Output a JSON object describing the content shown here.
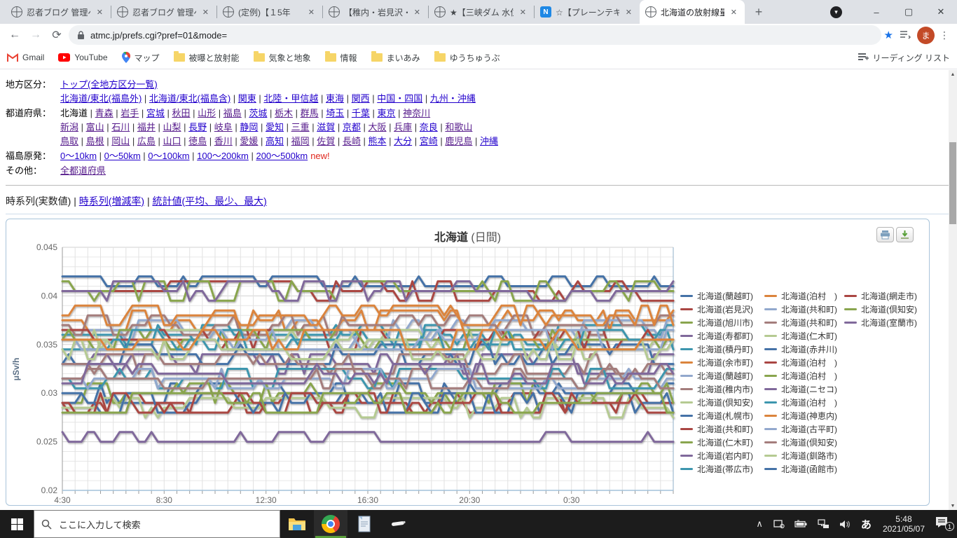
{
  "browser": {
    "tabs": [
      {
        "title": "忍者ブログ 管理ペ-",
        "icon": "globe",
        "active": false
      },
      {
        "title": "忍者ブログ 管理ペ-",
        "icon": "globe",
        "active": false
      },
      {
        "title": "(定例)【１5年",
        "icon": "globe",
        "active": false
      },
      {
        "title": "【稚内・岩見沢・函",
        "icon": "globe",
        "active": false
      },
      {
        "title": "★【三峡ダム 水位",
        "icon": "globe",
        "active": false
      },
      {
        "title": "☆【プレーンテキスト",
        "icon": "note",
        "active": false
      },
      {
        "title": "北海道の放射線量",
        "icon": "globe",
        "active": true
      }
    ],
    "note_icon_letter": "N",
    "new_tab_label": "+",
    "window_controls": {
      "tab_menu": "▾",
      "minimize": "–",
      "maximize": "▢",
      "close": "✕"
    },
    "address": {
      "url": "atmc.jp/prefs.cgi?pref=01&mode="
    },
    "toolbar": {
      "avatar_letter": "ま"
    },
    "bookmarks": [
      {
        "label": "Gmail",
        "icon": "gmail"
      },
      {
        "label": "YouTube",
        "icon": "youtube"
      },
      {
        "label": "マップ",
        "icon": "maps"
      },
      {
        "label": "被曝と放射能",
        "icon": "folder"
      },
      {
        "label": "気象と地象",
        "icon": "folder"
      },
      {
        "label": "情報",
        "icon": "folder"
      },
      {
        "label": "まいあみ",
        "icon": "folder"
      },
      {
        "label": "ゆうちゅうぶ",
        "icon": "folder"
      }
    ],
    "reading_list_label": "リーディング リスト"
  },
  "page": {
    "nav_rows": [
      {
        "label": "地方区分：",
        "lines": [
          [
            {
              "t": "トップ(全地方区分一覧)",
              "v": false
            }
          ],
          [
            {
              "t": "北海道/東北(福島外)",
              "v": false
            },
            {
              "t": "北海道/東北(福島含)",
              "v": false
            },
            {
              "t": "関東",
              "v": false
            },
            {
              "t": "北陸・甲信越",
              "v": false
            },
            {
              "t": "東海",
              "v": false
            },
            {
              "t": "関西",
              "v": false
            },
            {
              "t": "中国・四国",
              "v": false
            },
            {
              "t": "九州・沖縄",
              "v": false
            }
          ]
        ]
      },
      {
        "label": "都道府県：",
        "lines": [
          [
            {
              "t": "北海道",
              "plain": true
            },
            {
              "t": "青森",
              "v": true
            },
            {
              "t": "岩手",
              "v": true
            },
            {
              "t": "宮城",
              "v": false
            },
            {
              "t": "秋田",
              "v": true
            },
            {
              "t": "山形",
              "v": true
            },
            {
              "t": "福島",
              "v": true
            },
            {
              "t": "茨城",
              "v": false
            },
            {
              "t": "栃木",
              "v": true
            },
            {
              "t": "群馬",
              "v": true
            },
            {
              "t": "埼玉",
              "v": false
            },
            {
              "t": "千葉",
              "v": false
            },
            {
              "t": "東京",
              "v": false
            },
            {
              "t": "神奈川",
              "v": true
            }
          ],
          [
            {
              "t": "新潟",
              "v": true
            },
            {
              "t": "富山",
              "v": true
            },
            {
              "t": "石川",
              "v": true
            },
            {
              "t": "福井",
              "v": true
            },
            {
              "t": "山梨",
              "v": true
            },
            {
              "t": "長野",
              "v": false
            },
            {
              "t": "岐阜",
              "v": true
            },
            {
              "t": "静岡",
              "v": false
            },
            {
              "t": "愛知",
              "v": false
            },
            {
              "t": "三重",
              "v": true
            },
            {
              "t": "滋賀",
              "v": false
            },
            {
              "t": "京都",
              "v": false
            },
            {
              "t": "大阪",
              "v": true
            },
            {
              "t": "兵庫",
              "v": true
            },
            {
              "t": "奈良",
              "v": false
            },
            {
              "t": "和歌山",
              "v": true
            }
          ],
          [
            {
              "t": "鳥取",
              "v": true
            },
            {
              "t": "島根",
              "v": true
            },
            {
              "t": "岡山",
              "v": true
            },
            {
              "t": "広島",
              "v": true
            },
            {
              "t": "山口",
              "v": true
            },
            {
              "t": "徳島",
              "v": true
            },
            {
              "t": "香川",
              "v": true
            },
            {
              "t": "愛媛",
              "v": true
            },
            {
              "t": "高知",
              "v": false
            },
            {
              "t": "福岡",
              "v": true
            },
            {
              "t": "佐賀",
              "v": true
            },
            {
              "t": "長崎",
              "v": true
            },
            {
              "t": "熊本",
              "v": false
            },
            {
              "t": "大分",
              "v": false
            },
            {
              "t": "宮崎",
              "v": false
            },
            {
              "t": "鹿児島",
              "v": true
            },
            {
              "t": "沖縄",
              "v": false
            }
          ]
        ]
      },
      {
        "label": "福島原発：",
        "lines": [
          [
            {
              "t": "0～10km",
              "v": false
            },
            {
              "t": "0～50km",
              "v": false
            },
            {
              "t": "0～100km",
              "v": false
            },
            {
              "t": "100～200km",
              "v": false
            },
            {
              "t": "200～500km",
              "v": false,
              "suffix": "new!"
            }
          ]
        ]
      },
      {
        "label": "その他：",
        "lines": [
          [
            {
              "t": "全都道府県",
              "v": true
            }
          ]
        ]
      }
    ],
    "view_tabs": {
      "current": "時系列(実数値)",
      "links": [
        "時系列(増減率)",
        "統計値(平均、最少、最大)"
      ]
    }
  },
  "chart_data": {
    "type": "line",
    "title": "北海道",
    "title_suffix": " (日間)",
    "ylabel": "μSv/h",
    "ylim": [
      0.02,
      0.045
    ],
    "ytick_step": 0.005,
    "grid_step": 0.001,
    "x_labels": [
      "4:30",
      "8:30",
      "12:30",
      "16:30",
      "20:30",
      "0:30"
    ],
    "x_minutes_per_point": 15,
    "points_per_series": 97,
    "value_step": 0.001,
    "legend_columns": [
      14,
      14,
      3
    ],
    "palette": [
      "#4572A7",
      "#AA4643",
      "#89A54E",
      "#80699B",
      "#3D96AE",
      "#DB843D",
      "#92A8CD",
      "#A47D7C",
      "#B5CA92"
    ],
    "series": [
      {
        "name": "北海道(蘭越町)",
        "color_index": 0,
        "base": 0.041,
        "floor": true
      },
      {
        "name": "北海道(岩見沢)",
        "color_index": 1,
        "base": 0.0405
      },
      {
        "name": "北海道(旭川市)",
        "color_index": 2,
        "base": 0.0405
      },
      {
        "name": "北海道(寿都町)",
        "color_index": 3,
        "base": 0.033
      },
      {
        "name": "北海道(積丹町)",
        "color_index": 4,
        "base": 0.036
      },
      {
        "name": "北海道(余市町)",
        "color_index": 5,
        "base": 0.0375
      },
      {
        "name": "北海道(蘭越町)",
        "color_index": 6,
        "base": 0.0365
      },
      {
        "name": "北海道(稚内市)",
        "color_index": 7,
        "base": 0.037
      },
      {
        "name": "北海道(倶知安)",
        "color_index": 8,
        "base": 0.0355
      },
      {
        "name": "北海道(札幌市)",
        "color_index": 0,
        "base": 0.034
      },
      {
        "name": "北海道(共和町)",
        "color_index": 1,
        "base": 0.0355
      },
      {
        "name": "北海道(仁木町)",
        "color_index": 2,
        "base": 0.0355
      },
      {
        "name": "北海道(岩内町)",
        "color_index": 3,
        "base": 0.025,
        "floor": true
      },
      {
        "name": "北海道(帯広市)",
        "color_index": 4,
        "base": 0.0355
      },
      {
        "name": "北海道(泊村　)",
        "color_index": 5,
        "base": 0.038
      },
      {
        "name": "北海道(共和町)",
        "color_index": 6,
        "base": 0.0355
      },
      {
        "name": "北海道(共和町)",
        "color_index": 7,
        "base": 0.033
      },
      {
        "name": "北海道(仁木町)",
        "color_index": 8,
        "base": 0.0345
      },
      {
        "name": "北海道(赤井川)",
        "color_index": 0,
        "base": 0.03
      },
      {
        "name": "北海道(泊村　)",
        "color_index": 1,
        "base": 0.029
      },
      {
        "name": "北海道(泊村　)",
        "color_index": 2,
        "base": 0.03
      },
      {
        "name": "北海道(ニセコ)",
        "color_index": 3,
        "base": 0.0405
      },
      {
        "name": "北海道(泊村　)",
        "color_index": 4,
        "base": 0.0315
      },
      {
        "name": "北海道(神恵内)",
        "color_index": 5,
        "base": 0.0355
      },
      {
        "name": "北海道(古平町)",
        "color_index": 6,
        "base": 0.0315
      },
      {
        "name": "北海道(倶知安)",
        "color_index": 7,
        "base": 0.0315
      },
      {
        "name": "北海道(釧路市)",
        "color_index": 8,
        "base": 0.0285
      },
      {
        "name": "北海道(函館市)",
        "color_index": 0,
        "base": 0.029
      },
      {
        "name": "北海道(網走市)",
        "color_index": 1,
        "base": 0.029
      },
      {
        "name": "北海道(倶知安)",
        "color_index": 2,
        "base": 0.029
      },
      {
        "name": "北海道(室蘭市)",
        "color_index": 3,
        "base": 0.032
      }
    ]
  },
  "taskbar": {
    "search_placeholder": "ここに入力して検索",
    "tray": {
      "ime": "あ",
      "time": "5:48",
      "date": "2021/05/07",
      "badge": "1"
    }
  }
}
